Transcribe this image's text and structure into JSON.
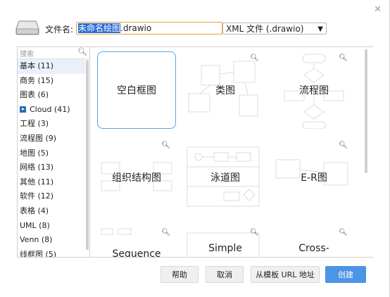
{
  "dialog": {
    "close_icon": "close-icon",
    "filename_label": "文件名:",
    "filename_selected": "未命名绘图",
    "filename_ext": ".drawio",
    "format_value": "XML 文件 (.drawio)",
    "format_chevron": "chevron-down-icon"
  },
  "search": {
    "placeholder": "搜索",
    "icon": "search-icon"
  },
  "categories": [
    {
      "label": "基本 (11)",
      "active": true
    },
    {
      "label": "商务 (15)"
    },
    {
      "label": "图表 (6)"
    },
    {
      "label": "Cloud (41)",
      "icon": "cloud-icon"
    },
    {
      "label": "工程 (3)"
    },
    {
      "label": "流程图 (9)"
    },
    {
      "label": "地图 (5)"
    },
    {
      "label": "网络 (13)"
    },
    {
      "label": "其他 (11)"
    },
    {
      "label": "软件 (12)"
    },
    {
      "label": "表格 (4)"
    },
    {
      "label": "UML (8)"
    },
    {
      "label": "Venn (8)"
    },
    {
      "label": "线框图 (5)"
    }
  ],
  "templates": [
    {
      "label": "空白框图"
    },
    {
      "label": "类图"
    },
    {
      "label": "流程图"
    },
    {
      "label": "组织结构图"
    },
    {
      "label": "泳道图"
    },
    {
      "label": "E-R图"
    },
    {
      "label": "Sequence"
    },
    {
      "label": "Simple"
    },
    {
      "label": "Cross-"
    }
  ],
  "buttons": {
    "help": "帮助",
    "cancel": "取消",
    "from_url": "从模板 URL 地址",
    "create": "创建"
  },
  "colors": {
    "accent": "#4c94e5",
    "selection": "#2b6cd6",
    "focus_border": "#e8a33a",
    "blank_tile_border": "#56a7ea"
  }
}
